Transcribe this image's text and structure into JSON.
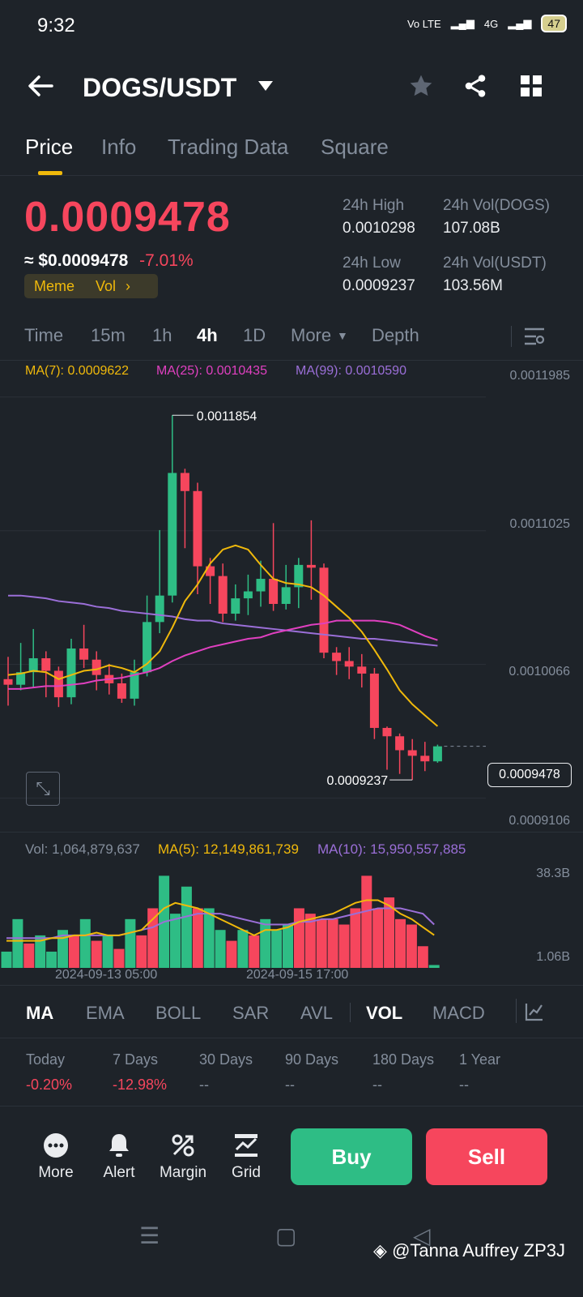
{
  "status": {
    "time": "9:32",
    "net1": "Vo LTE",
    "net2": "4G",
    "battery": "47"
  },
  "header": {
    "pair": "DOGS/USDT"
  },
  "tabs": [
    "Price",
    "Info",
    "Trading Data",
    "Square"
  ],
  "ticker": {
    "price": "0.0009478",
    "usd": "≈ $0.0009478",
    "change": "-7.01%",
    "tag_meme": "Meme",
    "tag_vol": "Vol",
    "high_label": "24h High",
    "high": "0.0010298",
    "low_label": "24h Low",
    "low": "0.0009237",
    "vol_dogs_label": "24h Vol(DOGS)",
    "vol_dogs": "107.08B",
    "vol_usdt_label": "24h Vol(USDT)",
    "vol_usdt": "103.56M"
  },
  "timeframes": [
    "Time",
    "15m",
    "1h",
    "4h",
    "1D",
    "More",
    "Depth"
  ],
  "ma": {
    "ma7": "MA(7): 0.0009622",
    "ma25": "MA(25): 0.0010435",
    "ma99": "MA(99): 0.0010590"
  },
  "price_axis": [
    "0.0011985",
    "0.0011025",
    "0.0010066",
    "0.0009106"
  ],
  "annotations": {
    "high": "0.0011854",
    "low": "0.0009237",
    "current": "0.0009478"
  },
  "vol_header": {
    "vol": "Vol: 1,064,879,637",
    "ma5": "MA(5): 12,149,861,739",
    "ma10": "MA(10): 15,950,557,885"
  },
  "vol_axis": [
    "38.3B",
    "1.06B"
  ],
  "time_axis": [
    "2024-09-13 05:00",
    "2024-09-15 17:00"
  ],
  "indicators": [
    "MA",
    "EMA",
    "BOLL",
    "SAR",
    "AVL",
    "VOL",
    "MACD"
  ],
  "performance": [
    {
      "label": "Today",
      "value": "-0.20%"
    },
    {
      "label": "7 Days",
      "value": "-12.98%"
    },
    {
      "label": "30 Days",
      "value": "--"
    },
    {
      "label": "90 Days",
      "value": "--"
    },
    {
      "label": "180 Days",
      "value": "--"
    },
    {
      "label": "1 Year",
      "value": "--"
    }
  ],
  "bottom": {
    "more": "More",
    "alert": "Alert",
    "margin": "Margin",
    "grid": "Grid",
    "buy": "Buy",
    "sell": "Sell"
  },
  "watermark": "@Tanna Auffrey ZP3J",
  "colors": {
    "up": "#2ebd85",
    "down": "#f6465d",
    "accent": "#f0b90b",
    "ma7": "#f0b90b",
    "ma25": "#e040c0",
    "ma99": "#9b6fd8"
  },
  "chart_data": {
    "type": "candlestick",
    "price_range": [
      0.00089,
      0.00121
    ],
    "candles": [
      [
        0.000996,
        0.000992,
        0.001012,
        0.000977
      ],
      [
        0.000992,
        0.001001,
        0.001022,
        0.000988
      ],
      [
        0.001001,
        0.001011,
        0.001032,
        0.00099
      ],
      [
        0.001011,
        0.001002,
        0.001016,
        0.000983
      ],
      [
        0.001002,
        0.000983,
        0.001005,
        0.000976
      ],
      [
        0.000983,
        0.001018,
        0.001025,
        0.000978
      ],
      [
        0.001018,
        0.00101,
        0.001035,
        0.001004
      ],
      [
        0.00101,
        0.000999,
        0.001016,
        0.000988
      ],
      [
        0.000999,
        0.000993,
        0.001007,
        0.000985
      ],
      [
        0.000993,
        0.000982,
        0.001,
        0.000979
      ],
      [
        0.000982,
        0.001001,
        0.00101,
        0.000977
      ],
      [
        0.001001,
        0.001037,
        0.001056,
        0.000998
      ],
      [
        0.001037,
        0.001056,
        0.001103,
        0.001029
      ],
      [
        0.001056,
        0.001144,
        0.0011854,
        0.001051
      ],
      [
        0.001144,
        0.001131,
        0.001147,
        0.00109
      ],
      [
        0.001131,
        0.001077,
        0.001137,
        0.001057
      ],
      [
        0.001077,
        0.00107,
        0.001083,
        0.00105
      ],
      [
        0.00107,
        0.001043,
        0.001079,
        0.001037
      ],
      [
        0.001043,
        0.001054,
        0.001064,
        0.001038
      ],
      [
        0.001054,
        0.001059,
        0.001071,
        0.001042
      ],
      [
        0.001059,
        0.001068,
        0.001081,
        0.001048
      ],
      [
        0.001068,
        0.00105,
        0.001108,
        0.001045
      ],
      [
        0.00105,
        0.001062,
        0.001078,
        0.001046
      ],
      [
        0.001062,
        0.001078,
        0.001083,
        0.001047
      ],
      [
        0.001078,
        0.001076,
        0.00111,
        0.001053
      ],
      [
        0.001076,
        0.001015,
        0.001079,
        0.001011
      ],
      [
        0.001015,
        0.001009,
        0.001019,
        0.000999
      ],
      [
        0.001009,
        0.001005,
        0.001019,
        0.000996
      ],
      [
        0.001005,
        0.001,
        0.001014,
        0.00099
      ],
      [
        0.001,
        0.000961,
        0.001004,
        0.000953
      ],
      [
        0.000961,
        0.000955,
        0.000962,
        0.000931
      ],
      [
        0.000955,
        0.000945,
        0.000957,
        0.000928
      ],
      [
        0.000945,
        0.000941,
        0.000953,
        0.0009237
      ],
      [
        0.000941,
        0.000937,
        0.000951,
        0.00093
      ],
      [
        0.000937,
        0.0009478,
        0.000949,
        0.000936
      ]
    ],
    "ma7": [
      0.000999,
      0.001,
      0.001002,
      0.001001,
      0.000996,
      0.000999,
      0.001002,
      0.001003,
      0.001006,
      0.001004,
      0.001001,
      0.001007,
      0.001016,
      0.001033,
      0.001052,
      0.001064,
      0.001079,
      0.001089,
      0.001092,
      0.001089,
      0.001078,
      0.001068,
      0.001065,
      0.001064,
      0.001062,
      0.001056,
      0.001048,
      0.00104,
      0.00103,
      0.001017,
      0.001003,
      0.000988,
      0.000978,
      0.00097,
      0.0009622
    ],
    "ma25": [
      0.000989,
      0.000989,
      0.00099,
      0.000991,
      0.000991,
      0.000992,
      0.000993,
      0.000995,
      0.000996,
      0.000997,
      0.000999,
      0.001001,
      0.001004,
      0.001009,
      0.001013,
      0.001016,
      0.001019,
      0.001021,
      0.001023,
      0.001025,
      0.001026,
      0.001029,
      0.001031,
      0.001033,
      0.001035,
      0.001036,
      0.001038,
      0.001038,
      0.001038,
      0.001038,
      0.001037,
      0.001035,
      0.001031,
      0.001027,
      0.001024
    ],
    "ma99": [
      0.001056,
      0.001056,
      0.001055,
      0.001054,
      0.001052,
      0.001051,
      0.00105,
      0.001048,
      0.001047,
      0.001045,
      0.001044,
      0.001043,
      0.001042,
      0.001041,
      0.001039,
      0.001038,
      0.001038,
      0.001036,
      0.001035,
      0.001034,
      0.001033,
      0.001032,
      0.001031,
      0.00103,
      0.001029,
      0.001028,
      0.001027,
      0.001026,
      0.001025,
      0.001025,
      0.001024,
      0.001023,
      0.001022,
      0.001021,
      0.00102
    ],
    "vol_range": [
      0,
      38.3
    ],
    "volumes": [
      6,
      18,
      9,
      12,
      6,
      14,
      12,
      18,
      10,
      12,
      7,
      18,
      12,
      22,
      34,
      20,
      30,
      22,
      22,
      14,
      10,
      14,
      12,
      18,
      14,
      16,
      22,
      20,
      18,
      18,
      16,
      22,
      34,
      22,
      26,
      18,
      16,
      8,
      1.06
    ],
    "vol_up": [
      true,
      true,
      false,
      true,
      true,
      true,
      false,
      true,
      false,
      true,
      false,
      true,
      false,
      false,
      true,
      true,
      true,
      false,
      true,
      true,
      false,
      true,
      false,
      true,
      true,
      true,
      false,
      false,
      false,
      false,
      false,
      false,
      false,
      false,
      false,
      false,
      false,
      false,
      true
    ],
    "vol_ma5": [
      10,
      10,
      10,
      10,
      11,
      11,
      12,
      12,
      13,
      12,
      12,
      13,
      14,
      18,
      22,
      24,
      23,
      22,
      20,
      18,
      16,
      14,
      12,
      14,
      14,
      15,
      17,
      18,
      19,
      20,
      22,
      24,
      25,
      25,
      23,
      20,
      18,
      15,
      12.1
    ],
    "vol_ma10": [
      11,
      11,
      11,
      11,
      11,
      12,
      12,
      12,
      12,
      12,
      12,
      13,
      14,
      15,
      17,
      18,
      19,
      20,
      20,
      20,
      19,
      18,
      17,
      16,
      16,
      16,
      17,
      17,
      18,
      18,
      19,
      20,
      21,
      22,
      22,
      22,
      21,
      20,
      16.0
    ]
  }
}
